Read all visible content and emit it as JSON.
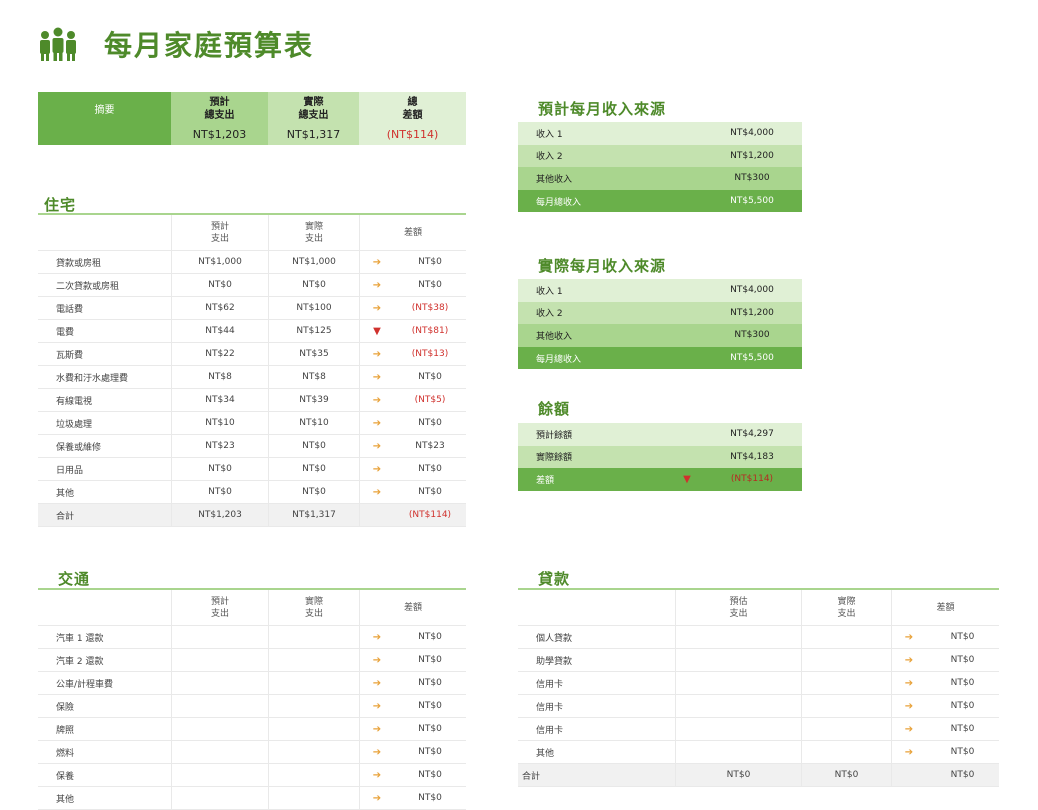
{
  "title": "每月家庭預算表",
  "summary": {
    "label": "摘要",
    "planned_label": "預計\n總支出",
    "planned_value": "NT$1,203",
    "actual_label": "實際\n總支出",
    "actual_value": "NT$1,317",
    "diff_label": "總\n差額",
    "diff_value": "(NT$114)"
  },
  "housing": {
    "title": "住宅",
    "headers": [
      "",
      "預計\n支出",
      "實際\n支出",
      "差額"
    ],
    "rows": [
      {
        "label": "貸款或房租",
        "planned": "NT$1,000",
        "actual": "NT$1,000",
        "arrow": "right",
        "diff": "NT$0",
        "neg": false
      },
      {
        "label": "二次貸款或房租",
        "planned": "NT$0",
        "actual": "NT$0",
        "arrow": "right",
        "diff": "NT$0",
        "neg": false
      },
      {
        "label": "電話費",
        "planned": "NT$62",
        "actual": "NT$100",
        "arrow": "right",
        "diff": "(NT$38)",
        "neg": true
      },
      {
        "label": "電費",
        "planned": "NT$44",
        "actual": "NT$125",
        "arrow": "down",
        "diff": "(NT$81)",
        "neg": true
      },
      {
        "label": "瓦斯費",
        "planned": "NT$22",
        "actual": "NT$35",
        "arrow": "right",
        "diff": "(NT$13)",
        "neg": true
      },
      {
        "label": "水費和汙水處理費",
        "planned": "NT$8",
        "actual": "NT$8",
        "arrow": "right",
        "diff": "NT$0",
        "neg": false
      },
      {
        "label": "有線電視",
        "planned": "NT$34",
        "actual": "NT$39",
        "arrow": "right",
        "diff": "(NT$5)",
        "neg": true
      },
      {
        "label": "垃圾處理",
        "planned": "NT$10",
        "actual": "NT$10",
        "arrow": "right",
        "diff": "NT$0",
        "neg": false
      },
      {
        "label": "保養或維修",
        "planned": "NT$23",
        "actual": "NT$0",
        "arrow": "right",
        "diff": "NT$23",
        "neg": false
      },
      {
        "label": "日用品",
        "planned": "NT$0",
        "actual": "NT$0",
        "arrow": "right",
        "diff": "NT$0",
        "neg": false
      },
      {
        "label": "其他",
        "planned": "NT$0",
        "actual": "NT$0",
        "arrow": "right",
        "diff": "NT$0",
        "neg": false
      }
    ],
    "total": {
      "label": "合計",
      "planned": "NT$1,203",
      "actual": "NT$1,317",
      "diff": "(NT$114)"
    }
  },
  "transport": {
    "title": "交通",
    "headers": [
      "",
      "預計\n支出",
      "實際\n支出",
      "差額"
    ],
    "rows": [
      {
        "label": "汽車 1 還款",
        "diff": "NT$0"
      },
      {
        "label": "汽車 2 還款",
        "diff": "NT$0"
      },
      {
        "label": "公車/計程車費",
        "diff": "NT$0"
      },
      {
        "label": "保險",
        "diff": "NT$0"
      },
      {
        "label": "牌照",
        "diff": "NT$0"
      },
      {
        "label": "燃料",
        "diff": "NT$0"
      },
      {
        "label": "保養",
        "diff": "NT$0"
      },
      {
        "label": "其他",
        "diff": "NT$0"
      }
    ]
  },
  "loans": {
    "title": "貸款",
    "headers": [
      "",
      "預估\n支出",
      "實際\n支出",
      "差額"
    ],
    "rows": [
      {
        "label": "個人貸款",
        "diff": "NT$0"
      },
      {
        "label": "助學貸款",
        "diff": "NT$0"
      },
      {
        "label": "信用卡",
        "diff": "NT$0"
      },
      {
        "label": "信用卡",
        "diff": "NT$0"
      },
      {
        "label": "信用卡",
        "diff": "NT$0"
      },
      {
        "label": "其他",
        "diff": "NT$0"
      }
    ],
    "total": {
      "label": "合計",
      "planned": "NT$0",
      "actual": "NT$0",
      "diff": "NT$0"
    }
  },
  "planned_income": {
    "title": "預計每月收入來源",
    "rows": [
      {
        "label": "收入 1",
        "value": "NT$4,000"
      },
      {
        "label": "收入 2",
        "value": "NT$1,200"
      },
      {
        "label": "其他收入",
        "value": "NT$300"
      },
      {
        "label": "每月總收入",
        "value": "NT$5,500"
      }
    ]
  },
  "actual_income": {
    "title": "實際每月收入來源",
    "rows": [
      {
        "label": "收入 1",
        "value": "NT$4,000"
      },
      {
        "label": "收入 2",
        "value": "NT$1,200"
      },
      {
        "label": "其他收入",
        "value": "NT$300"
      },
      {
        "label": "每月總收入",
        "value": "NT$5,500"
      }
    ]
  },
  "balance": {
    "title": "餘額",
    "rows": [
      {
        "label": "預計餘額",
        "value": "NT$4,297"
      },
      {
        "label": "實際餘額",
        "value": "NT$4,183"
      },
      {
        "label": "差額",
        "value": "(NT$114)",
        "arrow": "down"
      }
    ]
  },
  "colors": {
    "accent": "#4e8a2a",
    "green_dark": "#6ab04a",
    "green_mid": "#a9d58e",
    "green_light": "#c4e2af",
    "green_pale": "#e0f0d5",
    "negative": "#d0312d",
    "arrow_neutral": "#e8a23a"
  },
  "icons": {
    "logo": "family-icon",
    "arrow_right": "arrow-right-icon",
    "arrow_down": "arrow-down-icon"
  }
}
